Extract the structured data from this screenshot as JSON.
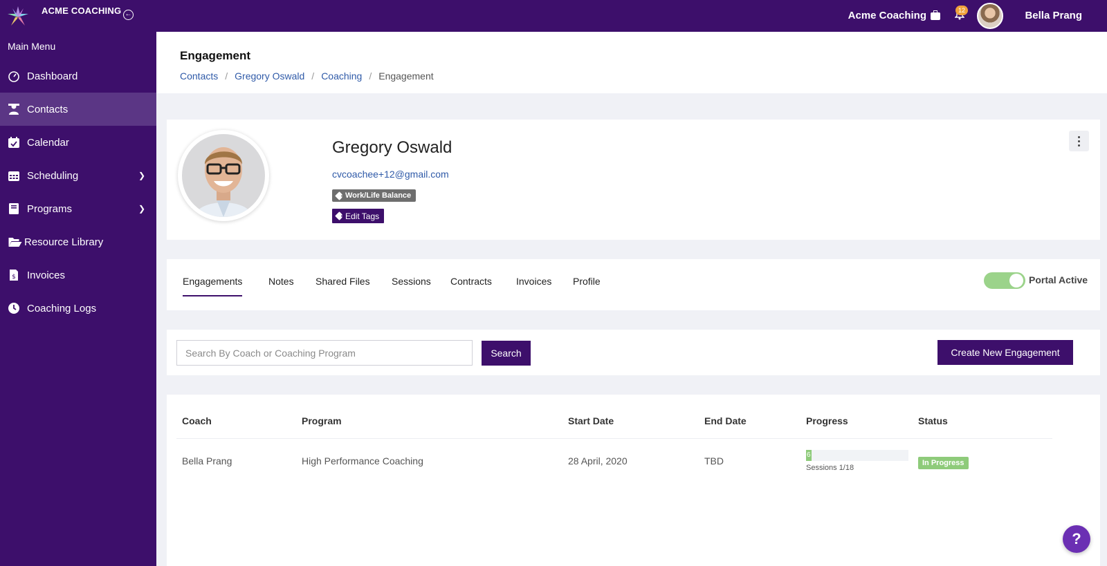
{
  "topbar": {
    "brand": "ACME COACHING",
    "company": "Acme Coaching",
    "notification_count": "12",
    "username": "Bella Prang"
  },
  "sidebar": {
    "title": "Main Menu",
    "items": [
      {
        "label": "Dashboard",
        "icon": "dashboard-icon"
      },
      {
        "label": "Contacts",
        "icon": "contacts-icon",
        "active": true
      },
      {
        "label": "Calendar",
        "icon": "calendar-check-icon"
      },
      {
        "label": "Scheduling",
        "icon": "calendar-grid-icon",
        "has_children": true
      },
      {
        "label": "Programs",
        "icon": "book-icon",
        "has_children": true
      },
      {
        "label": "Resource Library",
        "icon": "folder-open-icon"
      },
      {
        "label": "Invoices",
        "icon": "invoice-icon"
      },
      {
        "label": "Coaching Logs",
        "icon": "clock-icon"
      }
    ]
  },
  "header": {
    "title": "Engagement",
    "breadcrumbs": [
      "Contacts",
      "Gregory Oswald",
      "Coaching",
      "Engagement"
    ]
  },
  "profile": {
    "name": "Gregory Oswald",
    "email": "cvcoachee+12@gmail.com",
    "tag": "Work/Life Balance",
    "edit_tags": "Edit Tags"
  },
  "tabs": [
    {
      "label": "Engagements",
      "active": true
    },
    {
      "label": "Notes"
    },
    {
      "label": "Shared Files"
    },
    {
      "label": "Sessions"
    },
    {
      "label": "Contracts"
    },
    {
      "label": "Invoices"
    },
    {
      "label": "Profile"
    }
  ],
  "portal": {
    "label": "Portal Active",
    "active": true
  },
  "search": {
    "placeholder": "Search By Coach or Coaching Program",
    "value": "",
    "button": "Search",
    "create_button": "Create New Engagement"
  },
  "table": {
    "columns": [
      "Coach",
      "Program",
      "Start Date",
      "End Date",
      "Progress",
      "Status"
    ],
    "rows": [
      {
        "coach": "Bella Prang",
        "program": "High Performance Coaching",
        "start_date": "28 April, 2020",
        "end_date": "TBD",
        "progress_value": "6",
        "progress_fraction": 0.056,
        "progress_text": "Sessions 1/18",
        "status": "In Progress"
      }
    ]
  },
  "help": {
    "label": "?"
  },
  "colors": {
    "primary": "#3d0f6b",
    "sidebar_active": "#5b3685",
    "link": "#2f5aa8",
    "success": "#8ecb7a",
    "badge": "#f0a13c"
  }
}
